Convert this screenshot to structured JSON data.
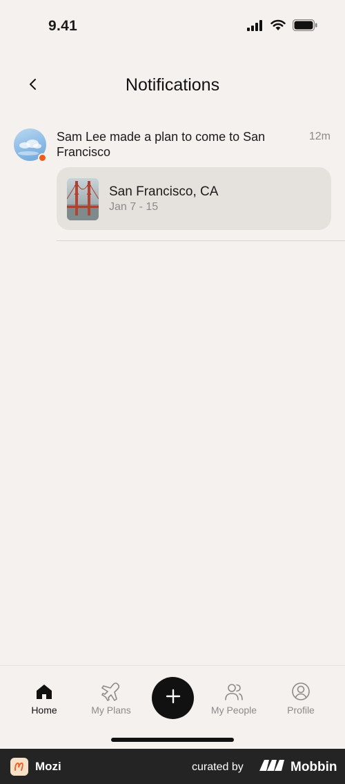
{
  "status_bar": {
    "time": "9.41",
    "icons": [
      "signal-icon",
      "wifi-icon",
      "battery-icon"
    ]
  },
  "header": {
    "title": "Notifications",
    "back_icon": "chevron-left-icon"
  },
  "notifications": [
    {
      "text": "Sam Lee made a plan to come to San Francisco",
      "time": "12m",
      "unread": true,
      "trip": {
        "title": "San Francisco, CA",
        "dates": "Jan 7 - 15"
      }
    }
  ],
  "tab_bar": {
    "items": [
      {
        "label": "Home",
        "icon": "home-icon",
        "active": true
      },
      {
        "label": "My Plans",
        "icon": "plane-icon",
        "active": false
      },
      {
        "label": "My People",
        "icon": "people-icon",
        "active": false
      },
      {
        "label": "Profile",
        "icon": "profile-icon",
        "active": false
      }
    ],
    "add_icon": "plus-icon"
  },
  "footer": {
    "app_name": "Mozi",
    "curated_by": "curated by",
    "brand": "Mobbin"
  },
  "colors": {
    "background": "#f5f1ee",
    "card": "#e5e2dd",
    "unread_dot": "#f05a1a",
    "muted_text": "#8c8a88",
    "footer_bg": "#242424"
  }
}
